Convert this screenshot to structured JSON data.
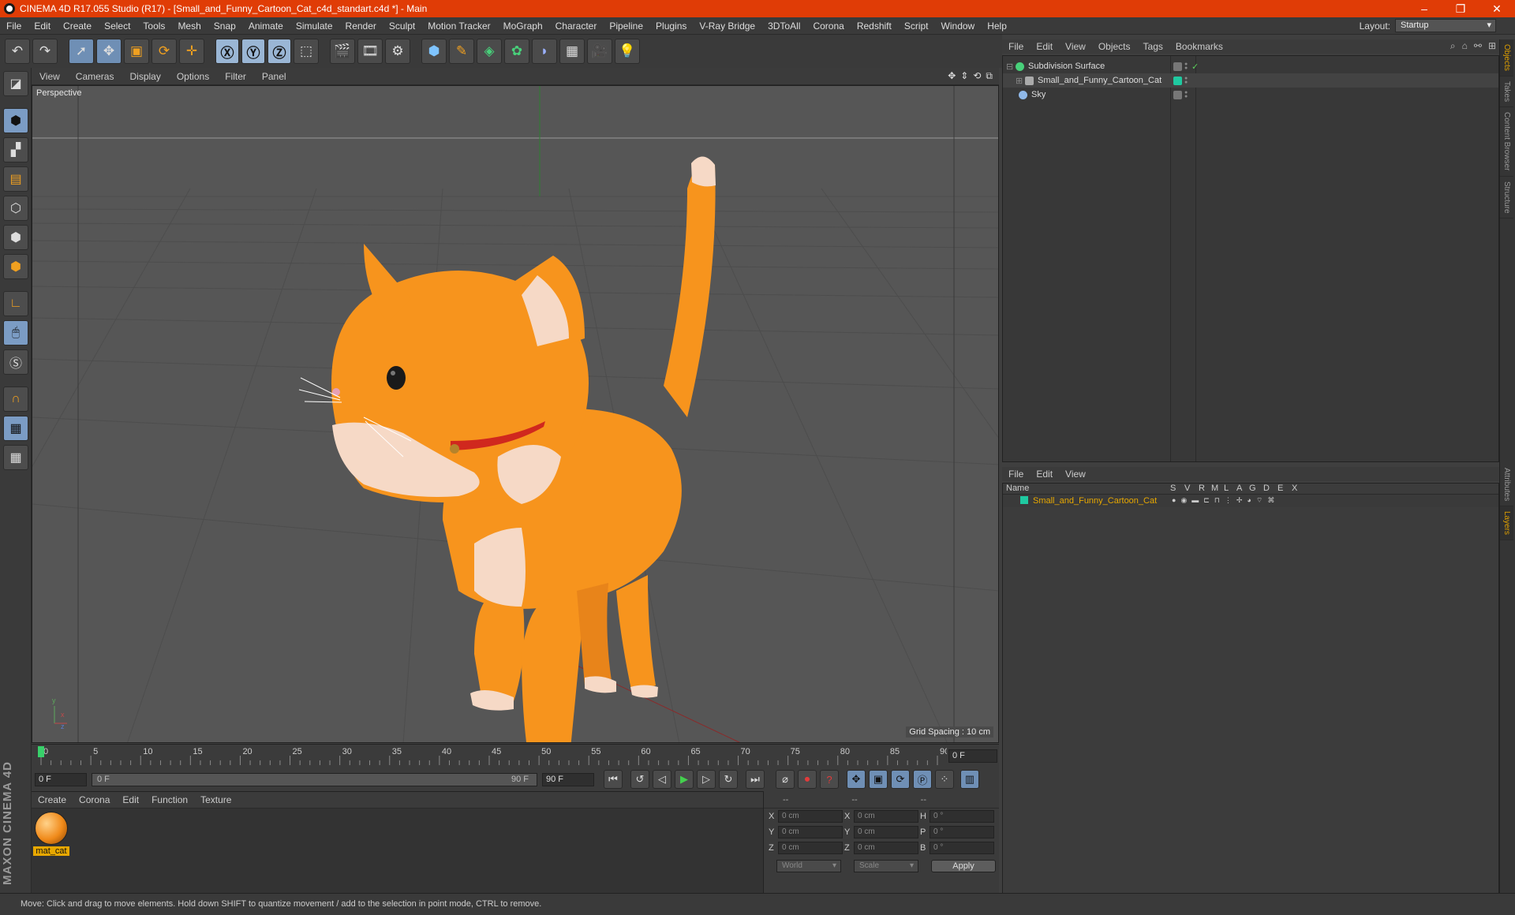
{
  "window": {
    "title": "CINEMA 4D R17.055 Studio (R17) - [Small_and_Funny_Cartoon_Cat_c4d_standart.c4d *] - Main"
  },
  "menubar": {
    "items": [
      "File",
      "Edit",
      "Create",
      "Select",
      "Tools",
      "Mesh",
      "Snap",
      "Animate",
      "Simulate",
      "Render",
      "Sculpt",
      "Motion Tracker",
      "MoGraph",
      "Character",
      "Pipeline",
      "Plugins",
      "V-Ray Bridge",
      "3DToAll",
      "Corona",
      "Redshift",
      "Script",
      "Window",
      "Help"
    ],
    "layout_label": "Layout:",
    "layout_value": "Startup"
  },
  "viewport": {
    "menu": [
      "View",
      "Cameras",
      "Display",
      "Options",
      "Filter",
      "Panel"
    ],
    "label": "Perspective",
    "grid_spacing": "Grid Spacing : 10 cm"
  },
  "timeline": {
    "ticks": [
      "0",
      "5",
      "10",
      "15",
      "20",
      "25",
      "30",
      "35",
      "40",
      "45",
      "50",
      "55",
      "60",
      "65",
      "70",
      "75",
      "80",
      "85",
      "90"
    ],
    "current_frame": "0 F"
  },
  "transport": {
    "start": "0 F",
    "range_start": "0 F",
    "range_end": "90 F",
    "end": "90 F"
  },
  "material_manager": {
    "menu": [
      "Create",
      "Corona",
      "Edit",
      "Function",
      "Texture"
    ],
    "materials": [
      {
        "name": "mat_cat"
      }
    ]
  },
  "coordinates": {
    "header": [
      "--",
      "--",
      "--"
    ],
    "rows": [
      {
        "l1": "X",
        "v1": "0 cm",
        "l2": "X",
        "v2": "0 cm",
        "l3": "H",
        "v3": "0 °"
      },
      {
        "l1": "Y",
        "v1": "0 cm",
        "l2": "Y",
        "v2": "0 cm",
        "l3": "P",
        "v3": "0 °"
      },
      {
        "l1": "Z",
        "v1": "0 cm",
        "l2": "Z",
        "v2": "0 cm",
        "l3": "B",
        "v3": "0 °"
      }
    ],
    "mode": "World",
    "transform": "Scale",
    "apply": "Apply"
  },
  "object_manager": {
    "menu": [
      "File",
      "Edit",
      "View",
      "Objects",
      "Tags",
      "Bookmarks"
    ],
    "objects": [
      {
        "name": "Subdivision Surface"
      },
      {
        "name": "Small_and_Funny_Cartoon_Cat"
      },
      {
        "name": "Sky"
      }
    ]
  },
  "layer_manager": {
    "menu": [
      "File",
      "Edit",
      "View"
    ],
    "columns": [
      "Name",
      "S",
      "V",
      "R",
      "M",
      "L",
      "A",
      "G",
      "D",
      "E",
      "X"
    ],
    "layers": [
      {
        "name": "Small_and_Funny_Cartoon_Cat",
        "color": "#1fc9a0"
      }
    ]
  },
  "side_tabs": [
    "Objects",
    "Takes",
    "Content Browser",
    "Structure",
    "Attributes",
    "Layers"
  ],
  "status": "Move: Click and drag to move elements. Hold down SHIFT to quantize movement / add to the selection in point mode, CTRL to remove.",
  "colors": {
    "title_bar": "#e03c06",
    "accent": "#e8a800",
    "layer_color": "#1fc9a0",
    "cat_orange": "#f7941d"
  },
  "icons": {
    "toolbar": [
      "undo-icon",
      "redo-icon",
      "select-arrow-icon",
      "move-icon",
      "scale-icon",
      "rotate-icon",
      "live-select-icon",
      "x-axis-icon",
      "y-axis-icon",
      "z-axis-icon",
      "coordinate-system-icon",
      "render-view-icon",
      "render-picture-viewer-icon",
      "edit-render-settings-icon",
      "cube-icon",
      "pen-spline-icon",
      "subdivision-icon",
      "array-icon",
      "deformer-icon",
      "floor-icon",
      "camera-icon",
      "light-icon"
    ],
    "left": [
      "model-mode-icon",
      "texture-mode-icon",
      "workplane-icon",
      "point-mode-icon",
      "edge-mode-icon",
      "polygon-mode-icon",
      "axis-mode-icon",
      "tweak-mode-icon",
      "snap-icon",
      "magnet-icon",
      "locked-workplane-icon",
      "planar-workplane-icon"
    ]
  }
}
